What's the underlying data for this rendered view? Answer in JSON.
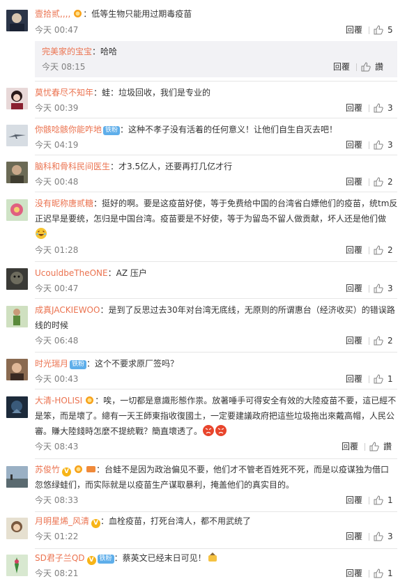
{
  "labels": {
    "reply": "回覆",
    "like_word": "讚"
  },
  "colors": {
    "username": "#eb7350",
    "fan_badge": "#5eaeea",
    "v_badge": "#f7b417"
  },
  "comments": [
    {
      "user": "壹拾贰,,,,",
      "text": "：低等生物只能用过期毒疫苗",
      "time": "今天 00:47",
      "likes": "5",
      "sub": {
        "user": "完美家的宝宝",
        "text": "：哈哈",
        "time": "今天 08:15"
      }
    },
    {
      "user": "莫忧春尽不知年",
      "text": "：蛙：垃圾回收，我们是专业的",
      "time": "今天 00:39",
      "likes": "3"
    },
    {
      "user": "你骸唸骸你能咋地",
      "badge": "铁粉",
      "text": "：这种不孝子没有活着的任何意义！让他们自生自灭去吧！",
      "time": "今天 04:19",
      "likes": "3"
    },
    {
      "user": "脑科和骨科民间医生",
      "text": "：才3.5亿人，还要再打几亿才行",
      "time": "今天 00:48",
      "likes": "2"
    },
    {
      "user": "没有昵称唐贰糖",
      "text": "：挺好的啊。要是这疫苗好使，等于免费给中国的台湾省白嫖他们的疫苗，统tm反",
      "text2": "正迟早是要统，怎归是中国台湾。疫苗要是不好使，等于为留岛不留人做贡献，坏人还是他们做",
      "time": "今天 01:28",
      "likes": "2"
    },
    {
      "user": "UcouldbeTheONE",
      "text": "：AZ 压户",
      "time": "今天 00:47",
      "likes": "3"
    },
    {
      "user": "成真JACKIEWOO",
      "text": "：是到了反思过去30年对台湾无底线，无原则的所谓惠台（经济收买）的错误路",
      "text2": "线的时候",
      "time": "今天 06:48",
      "likes": "2"
    },
    {
      "user": "时光瑞月",
      "badge": "铁粉",
      "text": "：这个不要求原厂签吗？",
      "time": "今天 00:43",
      "likes": "1"
    },
    {
      "user": "大清-HOLISI",
      "text": "：唉，一切都是意識形態作祟。放著唾手可得安全有效的大陸疫苗不要，這已經不",
      "text2": "是笨，而是壞了。總有一天王師東指收復國土，一定要建議政府把這些垃圾拖出來戴高帽，人民公",
      "text3": "審。賺大陸錢時怎麼不提統戰？簡直壞透了。",
      "time": "今天 08:43",
      "likes": "讚"
    },
    {
      "user": "苏俊竹",
      "text": "：台蛙不是因为政治偏见不要，他们才不管老百姓死不死，而是以疫谋独为借口",
      "text2": "忽悠绿蛙们，而实际就是以疫苗生产谋取暴利，掩盖他们的真实目的。",
      "time": "今天 08:33",
      "likes": "1"
    },
    {
      "user": "月明星烯_风清",
      "text": "：血栓疫苗，打死台湾人，都不用武统了",
      "time": "今天 01:22",
      "likes": "3"
    },
    {
      "user": "SD君子兰QD",
      "badge": "铁粉",
      "text": "：蔡英文已经末日可见！",
      "time": "今天 08:21",
      "likes": "1"
    }
  ]
}
